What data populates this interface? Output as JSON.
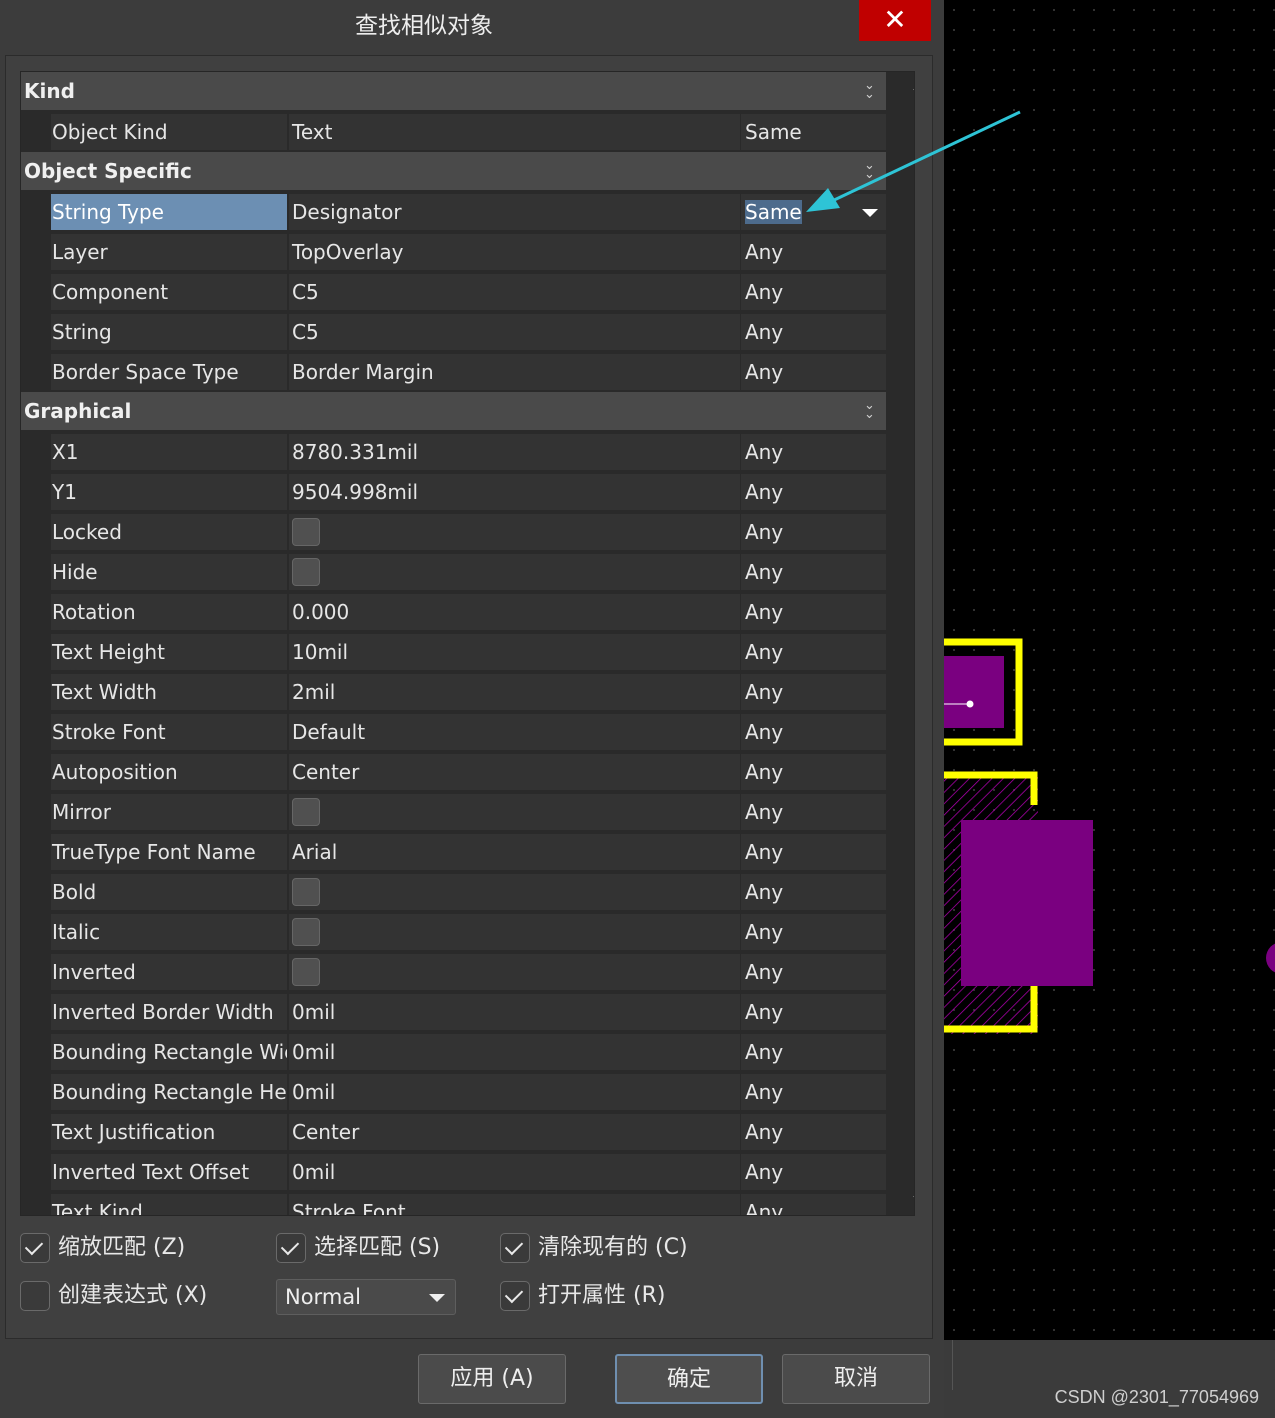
{
  "dialog": {
    "title": "查找相似对象",
    "close_glyph": "✕"
  },
  "categories": {
    "kind": "Kind",
    "object_specific": "Object Specific",
    "graphical": "Graphical"
  },
  "rows": {
    "object_kind": {
      "name": "Object Kind",
      "value": "Text",
      "mode": "Same"
    },
    "string_type": {
      "name": "String Type",
      "value": "Designator",
      "mode": "Same"
    },
    "layer": {
      "name": "Layer",
      "value": "TopOverlay",
      "mode": "Any"
    },
    "component": {
      "name": "Component",
      "value": "C5",
      "mode": "Any"
    },
    "string": {
      "name": "String",
      "value": "C5",
      "mode": "Any"
    },
    "border_space_type": {
      "name": "Border Space Type",
      "value": "Border Margin",
      "mode": "Any"
    },
    "x1": {
      "name": "X1",
      "value": "8780.331mil",
      "mode": "Any"
    },
    "y1": {
      "name": "Y1",
      "value": "9504.998mil",
      "mode": "Any"
    },
    "locked": {
      "name": "Locked",
      "mode": "Any"
    },
    "hide": {
      "name": "Hide",
      "mode": "Any"
    },
    "rotation": {
      "name": "Rotation",
      "value": "0.000",
      "mode": "Any"
    },
    "text_height": {
      "name": "Text Height",
      "value": "10mil",
      "mode": "Any"
    },
    "text_width": {
      "name": "Text Width",
      "value": "2mil",
      "mode": "Any"
    },
    "stroke_font": {
      "name": "Stroke Font",
      "value": "Default",
      "mode": "Any"
    },
    "autoposition": {
      "name": "Autoposition",
      "value": "Center",
      "mode": "Any"
    },
    "mirror": {
      "name": "Mirror",
      "mode": "Any"
    },
    "truetype_font_name": {
      "name": "TrueType Font Name",
      "value": "Arial",
      "mode": "Any"
    },
    "bold": {
      "name": "Bold",
      "mode": "Any"
    },
    "italic": {
      "name": "Italic",
      "mode": "Any"
    },
    "inverted": {
      "name": "Inverted",
      "mode": "Any"
    },
    "inverted_border_width": {
      "name": "Inverted Border Width",
      "value": "0mil",
      "mode": "Any"
    },
    "bounding_rect_width": {
      "name": "Bounding Rectangle Wic",
      "value": "0mil",
      "mode": "Any"
    },
    "bounding_rect_height": {
      "name": "Bounding Rectangle Hei",
      "value": "0mil",
      "mode": "Any"
    },
    "text_justification": {
      "name": "Text Justification",
      "value": "Center",
      "mode": "Any"
    },
    "inverted_text_offset": {
      "name": "Inverted Text Offset",
      "value": "0mil",
      "mode": "Any"
    },
    "text_kind": {
      "name": "Text Kind",
      "value": "Stroke Font",
      "mode": "Any"
    }
  },
  "options": {
    "zoom_matching": {
      "label": "缩放匹配 (Z)",
      "checked": true
    },
    "select_matching": {
      "label": "选择匹配 (S)",
      "checked": true
    },
    "clear_existing": {
      "label": "清除现有的 (C)",
      "checked": true
    },
    "create_expression": {
      "label": "创建表达式 (X)",
      "checked": false
    },
    "mask_mode": {
      "selected": "Normal"
    },
    "open_properties": {
      "label": "打开属性 (R)",
      "checked": true
    }
  },
  "buttons": {
    "apply": "应用 (A)",
    "ok": "确定",
    "cancel": "取消"
  },
  "watermark": "CSDN @2301_77054969",
  "colors": {
    "accent_selection": "#6c8fb3",
    "annotation_arrow": "#2ec4d6",
    "pcb_pad": "#7a0080",
    "pcb_silkscreen": "#ffff00",
    "close_button": "#c00000"
  }
}
